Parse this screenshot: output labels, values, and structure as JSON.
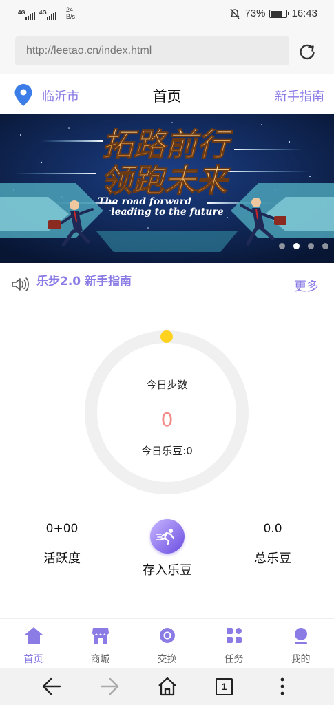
{
  "status_bar": {
    "network_1": "4G",
    "network_2": "4G",
    "speed_value": "24",
    "speed_unit": "B/s",
    "battery_percent": "73%",
    "battery_level": 0.73,
    "time": "16:43"
  },
  "browser": {
    "url": "http://leetao.cn/index.html",
    "tab_count": "1"
  },
  "header": {
    "city": "临沂市",
    "title": "首页",
    "guide": "新手指南"
  },
  "banner": {
    "headline_line1": "拓路前行",
    "headline_line2": "领跑未来",
    "subtitle_line1": "The road forward",
    "subtitle_line2": "leading to the future",
    "slide_count": 4,
    "active_slide": 2
  },
  "notice": {
    "text": "乐步2.0 新手指南",
    "more": "更多"
  },
  "steps": {
    "label": "今日步数",
    "value": "0",
    "beans_label": "今日乐豆:0",
    "progress": 0
  },
  "stats": {
    "activity_value": "0+00",
    "activity_label": "活跃度",
    "deposit_label": "存入乐豆",
    "total_value": "0.0",
    "total_label": "总乐豆"
  },
  "tabs": [
    {
      "label": "首页",
      "icon": "home-icon",
      "active": true
    },
    {
      "label": "商城",
      "icon": "store-icon",
      "active": false
    },
    {
      "label": "交换",
      "icon": "exchange-icon",
      "active": false
    },
    {
      "label": "任务",
      "icon": "tasks-icon",
      "active": false
    },
    {
      "label": "我的",
      "icon": "profile-icon",
      "active": false
    }
  ],
  "colors": {
    "accent": "#8a7be5",
    "steps_value": "#f08b86",
    "progress_dot": "#ffd21f",
    "ring": "#f0f0f0"
  }
}
